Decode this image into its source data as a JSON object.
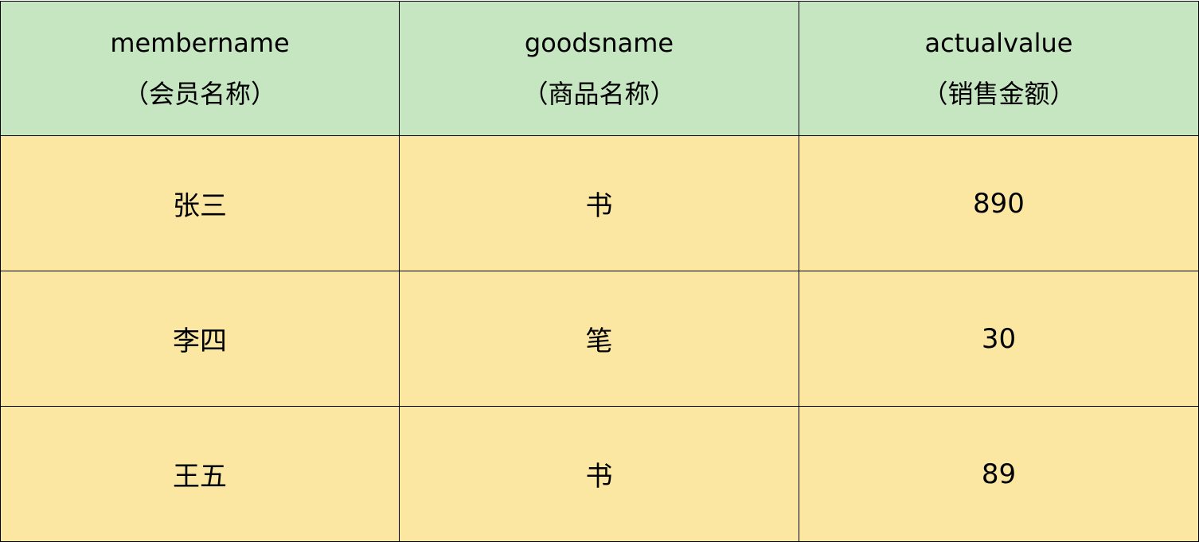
{
  "colors": {
    "header_bg": "#c6e6c1",
    "body_bg": "#fbe7a2",
    "border": "#000000",
    "text": "#000000"
  },
  "table": {
    "headers": [
      {
        "en": "membername",
        "zh": "（会员名称）"
      },
      {
        "en": "goodsname",
        "zh": "（商品名称）"
      },
      {
        "en": "actualvalue",
        "zh": "（销售金额）"
      }
    ],
    "rows": [
      [
        "张三",
        "书",
        "890"
      ],
      [
        "李四",
        "笔",
        "30"
      ],
      [
        "王五",
        "书",
        "89"
      ]
    ]
  }
}
